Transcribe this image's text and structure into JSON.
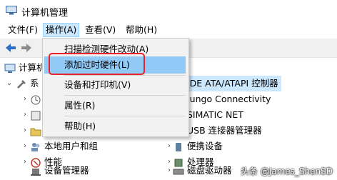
{
  "window": {
    "title": "计算机管理"
  },
  "menubar": {
    "items": [
      "文件(F)",
      "操作(A)",
      "查看(V)",
      "帮助(H)"
    ],
    "active": "操作(A)"
  },
  "tree": {
    "root": "计算机",
    "system": "系",
    "local_users": "本地用户和组",
    "performance": "性能",
    "device_manager": "设备管理器"
  },
  "right_pane": {
    "items": [
      "IDE ATA/ATAPI 控制器",
      "Jungo Connectivity",
      "SIMATIC NET",
      "USB 连接器管理器",
      "便携设备",
      "处理器",
      "磁盘驱动器"
    ],
    "partial_header": "n"
  },
  "dropdown": {
    "items": [
      "扫描检测硬件改动(A)",
      "添加过时硬件(L)",
      "设备和打印机(V)",
      "属性(R)",
      "帮助(H)"
    ],
    "highlighted": "添加过时硬件(L)"
  },
  "watermark": "头条 @James_ShenSD",
  "colors": {
    "highlight": "#91c9f7",
    "selection": "#cce8ff",
    "annotation_border": "#e8242a"
  }
}
